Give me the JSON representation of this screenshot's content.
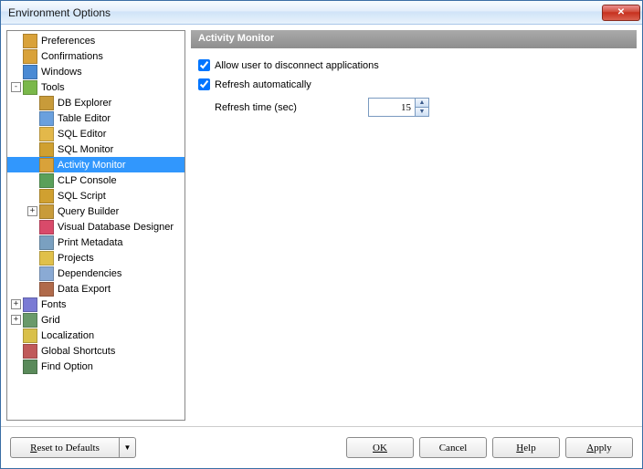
{
  "window": {
    "title": "Environment Options"
  },
  "tree": {
    "items": [
      {
        "label": "Preferences",
        "depth": 1,
        "expander": "",
        "icon": "#d9a23a"
      },
      {
        "label": "Confirmations",
        "depth": 1,
        "expander": "",
        "icon": "#d9a23a"
      },
      {
        "label": "Windows",
        "depth": 1,
        "expander": "",
        "icon": "#4a8ad4"
      },
      {
        "label": "Tools",
        "depth": 1,
        "expander": "-",
        "icon": "#7ab84a"
      },
      {
        "label": "DB Explorer",
        "depth": 2,
        "expander": "",
        "icon": "#c89b3a"
      },
      {
        "label": "Table Editor",
        "depth": 2,
        "expander": "",
        "icon": "#6aa0de"
      },
      {
        "label": "SQL Editor",
        "depth": 2,
        "expander": "",
        "icon": "#e3b84a"
      },
      {
        "label": "SQL Monitor",
        "depth": 2,
        "expander": "",
        "icon": "#d0a030"
      },
      {
        "label": "Activity Monitor",
        "depth": 2,
        "expander": "",
        "icon": "#d9a23a",
        "selected": true
      },
      {
        "label": "CLP Console",
        "depth": 2,
        "expander": "",
        "icon": "#5aa05a"
      },
      {
        "label": "SQL Script",
        "depth": 2,
        "expander": "",
        "icon": "#d0a030"
      },
      {
        "label": "Query Builder",
        "depth": 2,
        "expander": "+",
        "icon": "#c89b3a"
      },
      {
        "label": "Visual Database Designer",
        "depth": 2,
        "expander": "",
        "icon": "#d94a6a"
      },
      {
        "label": "Print Metadata",
        "depth": 2,
        "expander": "",
        "icon": "#7aa0c0"
      },
      {
        "label": "Projects",
        "depth": 2,
        "expander": "",
        "icon": "#e0c04a"
      },
      {
        "label": "Dependencies",
        "depth": 2,
        "expander": "",
        "icon": "#8aaad4"
      },
      {
        "label": "Data Export",
        "depth": 2,
        "expander": "",
        "icon": "#b06a4a"
      },
      {
        "label": "Fonts",
        "depth": 1,
        "expander": "+",
        "icon": "#7a7ad4"
      },
      {
        "label": "Grid",
        "depth": 1,
        "expander": "+",
        "icon": "#6a9a6a"
      },
      {
        "label": "Localization",
        "depth": 1,
        "expander": "",
        "icon": "#d9c04a"
      },
      {
        "label": "Global Shortcuts",
        "depth": 1,
        "expander": "",
        "icon": "#c05a5a"
      },
      {
        "label": "Find Option",
        "depth": 1,
        "expander": "",
        "icon": "#5a8a5a"
      }
    ]
  },
  "detail": {
    "header": "Activity Monitor",
    "allow_disconnect": {
      "label": "Allow user to disconnect applications",
      "checked": true
    },
    "refresh_auto": {
      "label": "Refresh automatically",
      "checked": true
    },
    "refresh_time": {
      "label": "Refresh time (sec)",
      "value": "15"
    }
  },
  "buttons": {
    "reset": "Reset to Defaults",
    "ok": "OK",
    "cancel": "Cancel",
    "help": "Help",
    "apply": "Apply"
  }
}
